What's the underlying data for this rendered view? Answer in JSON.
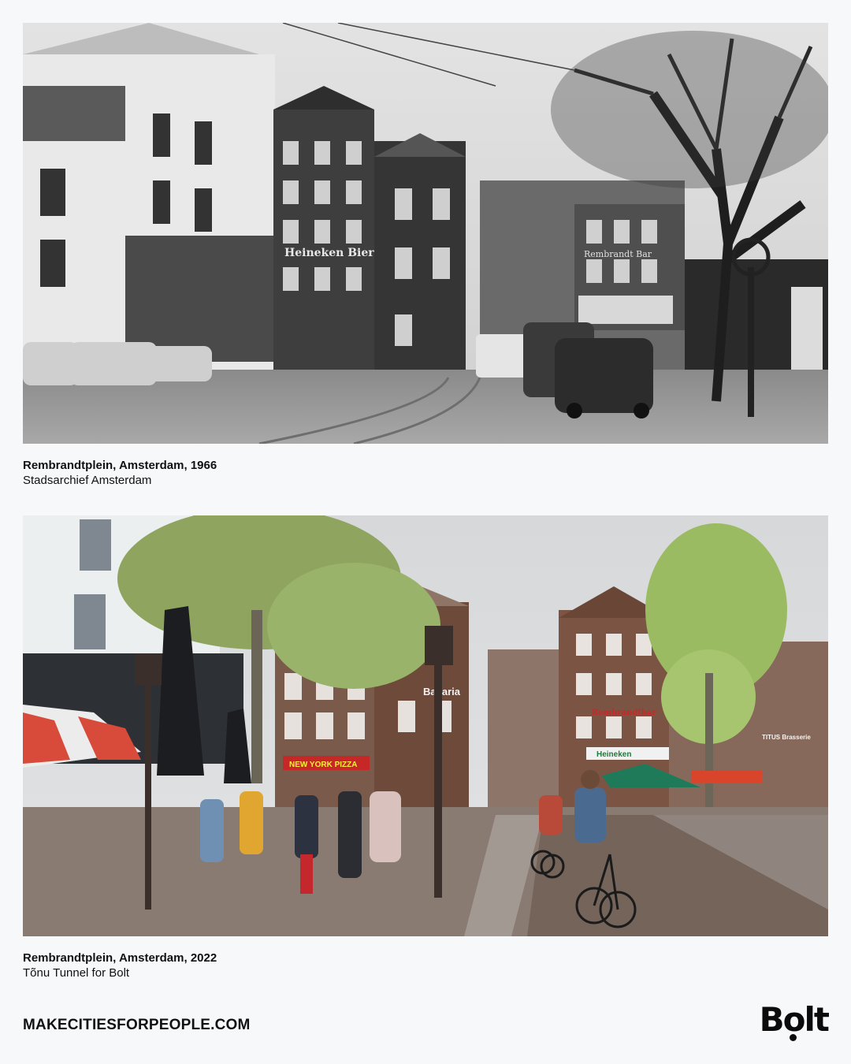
{
  "photos": [
    {
      "title": "Rembrandtplein, Amsterdam, 1966",
      "credit": "Stadsarchief Amsterdam",
      "signs": {
        "heineken": "Heineken Bier",
        "rembrandt": "Rembrandt Bar"
      }
    },
    {
      "title": "Rembrandtplein, Amsterdam, 2022",
      "credit": "Tõnu Tunnel for Bolt",
      "signs": {
        "bavaria": "Bavaria",
        "newyork": "NEW YORK PIZZA",
        "rembrandt": "Rembrandtbar",
        "heineken": "Heineken",
        "titus": "TITUS Brasserie"
      }
    }
  ],
  "footer": {
    "url": "MAKECITIESFORPEOPLE.COM",
    "logo": "Bolt"
  },
  "colors": {
    "background": "#f7f8fa",
    "text": "#111111"
  }
}
